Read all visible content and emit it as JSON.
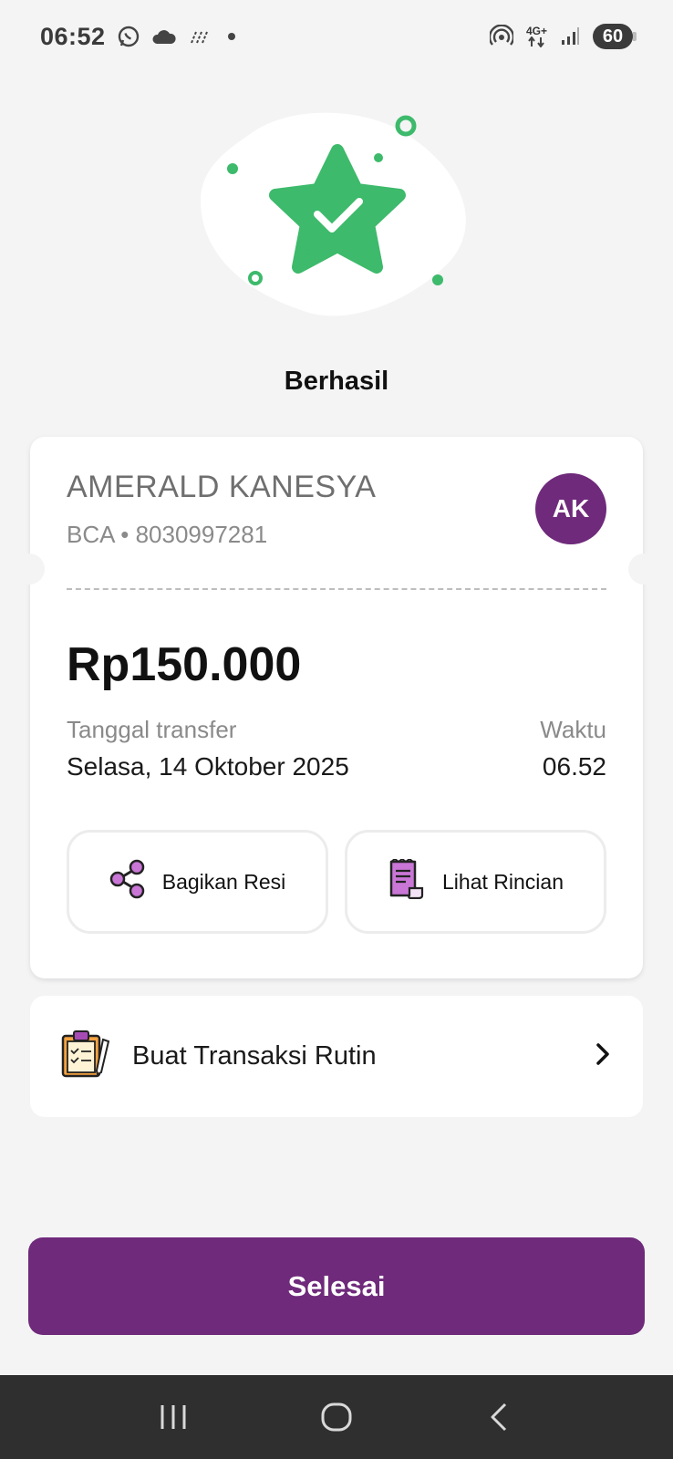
{
  "status_bar": {
    "time": "06:52",
    "network": "4G+",
    "battery": "60",
    "icons": [
      "whatsapp-icon",
      "cloud-icon",
      "rain-icon",
      "hotspot-icon",
      "network-arrows-icon",
      "signal-icon",
      "battery-icon"
    ]
  },
  "page": {
    "title": "Berhasil",
    "illustration": "success-star-check-icon"
  },
  "receipt": {
    "recipient_name": "AMERALD KANESYA",
    "recipient_account": "BCA • 8030997281",
    "avatar_initials": "AK",
    "amount": "Rp150.000",
    "date_label": "Tanggal transfer",
    "date_value": "Selasa, 14 Oktober 2025",
    "time_label": "Waktu",
    "time_value": "06.52",
    "share_button": "Bagikan Resi",
    "detail_button": "Lihat Rincian"
  },
  "routine": {
    "label": "Buat Transaksi Rutin",
    "icon": "clipboard-icon"
  },
  "finish_button": "Selesai",
  "nav": [
    "recent-apps-icon",
    "home-icon",
    "back-icon"
  ],
  "colors": {
    "brand_purple": "#6f2a7b",
    "success_green": "#3dba6b",
    "background": "#f4f4f5"
  }
}
